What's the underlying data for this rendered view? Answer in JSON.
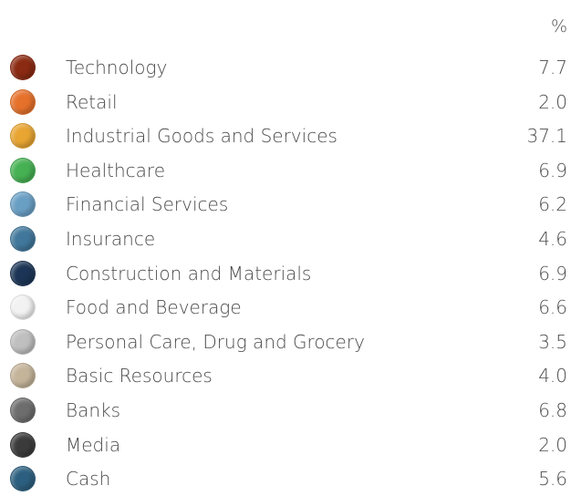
{
  "chart_data": {
    "type": "table",
    "unit_label": "%",
    "categories": [
      "Technology",
      "Retail",
      "Industrial Goods and Services",
      "Healthcare",
      "Financial Services",
      "Insurance",
      "Construction and Materials",
      "Food and Beverage",
      "Personal Care, Drug and Grocery",
      "Basic Resources",
      "Banks",
      "Media",
      "Cash"
    ],
    "values": [
      "7.7",
      "2.0",
      "37.1",
      "6.9",
      "6.2",
      "4.6",
      "6.9",
      "6.6",
      "3.5",
      "4.0",
      "6.8",
      "2.0",
      "5.6"
    ],
    "colors": [
      "#8b2a12",
      "#e6712b",
      "#e8a532",
      "#45b152",
      "#6a9fc4",
      "#40779b",
      "#1c3556",
      "#f2f2f2",
      "#bfbfbf",
      "#c4b49a",
      "#6d6d6d",
      "#3b3b3b",
      "#2c5f7f"
    ]
  }
}
